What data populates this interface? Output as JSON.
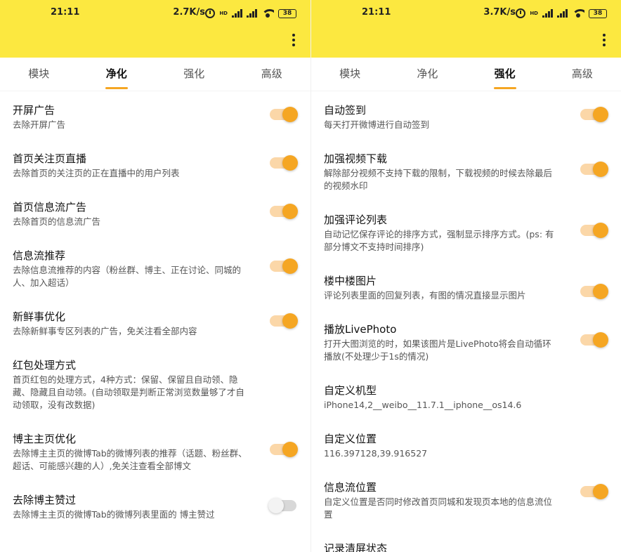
{
  "colors": {
    "appbar": "#fce840",
    "accent": "#f5a623"
  },
  "left": {
    "status": {
      "time": "21:11",
      "net": "2.7K/s",
      "hd": "HD",
      "battery": "38"
    },
    "tabs": [
      {
        "label": "模块"
      },
      {
        "label": "净化",
        "active": true
      },
      {
        "label": "强化"
      },
      {
        "label": "高级"
      }
    ],
    "items": [
      {
        "title": "开屏广告",
        "desc": "去除开屏广告",
        "on": true
      },
      {
        "title": "首页关注页直播",
        "desc": "去除首页的关注页的正在直播中的用户列表",
        "on": true
      },
      {
        "title": "首页信息流广告",
        "desc": "去除首页的信息流广告",
        "on": true
      },
      {
        "title": "信息流推荐",
        "desc": "去除信息流推荐的内容（粉丝群、博主、正在讨论、同城的人、加入超话）",
        "on": true
      },
      {
        "title": "新鲜事优化",
        "desc": "去除新鲜事专区列表的广告，免关注看全部内容",
        "on": true
      },
      {
        "title": "红包处理方式",
        "desc": "首页红包的处理方式，4种方式：保留、保留且自动领、隐藏、隐藏且自动领。(自动领取是判断正常浏览数量够了才自动领取，没有改数据)"
      },
      {
        "title": "博主主页优化",
        "desc": "去除博主主页的微博Tab的微博列表的推荐（话题、粉丝群、超话、可能感兴趣的人）,免关注查看全部博文",
        "on": true
      },
      {
        "title": "去除博主赞过",
        "desc": "去除博主主页的微博Tab的微博列表里面的 博主赞过",
        "on": false
      }
    ]
  },
  "right": {
    "status": {
      "time": "21:11",
      "net": "3.7K/s",
      "hd": "HD",
      "battery": "38"
    },
    "tabs": [
      {
        "label": "模块"
      },
      {
        "label": "净化"
      },
      {
        "label": "强化",
        "active": true
      },
      {
        "label": "高级"
      }
    ],
    "items": [
      {
        "title": "自动签到",
        "desc": "每天打开微博进行自动签到",
        "on": true
      },
      {
        "title": "加强视频下载",
        "desc": "解除部分视频不支持下载的限制，下载视频的时候去除最后的视频水印",
        "on": true
      },
      {
        "title": "加强评论列表",
        "desc": "自动记忆保存评论的排序方式，强制显示排序方式。(ps: 有部分博文不支持时间排序)",
        "on": true
      },
      {
        "title": "楼中楼图片",
        "desc": "评论列表里面的回复列表，有图的情况直接显示图片",
        "on": true
      },
      {
        "title": "播放LivePhoto",
        "desc": "打开大图浏览的时，如果该图片是LivePhoto将会自动循环播放(不处理少于1s的情况)",
        "on": true
      },
      {
        "title": "自定义机型",
        "desc": "iPhone14,2__weibo__11.7.1__iphone__os14.6"
      },
      {
        "title": "自定义位置",
        "desc": "116.397128,39.916527"
      },
      {
        "title": "信息流位置",
        "desc": "自定义位置是否同时修改首页同城和发现页本地的信息流位置",
        "on": true
      },
      {
        "title": "记录清屏状态",
        "desc": ""
      }
    ]
  }
}
